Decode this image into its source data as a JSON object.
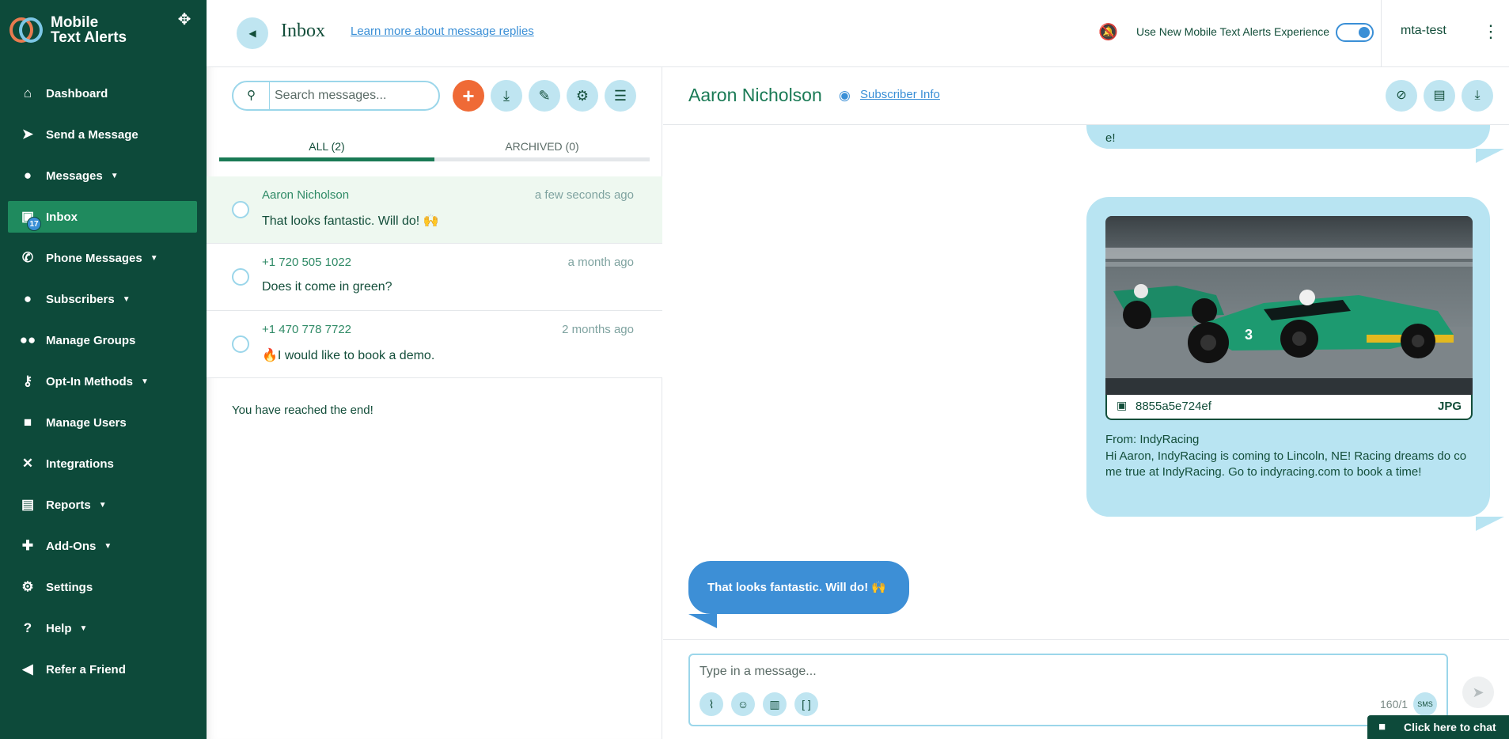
{
  "brand": {
    "line1": "Mobile",
    "line2": "Text Alerts"
  },
  "sidebar": {
    "items": [
      {
        "label": "Dashboard",
        "icon": "home-icon",
        "caret": false
      },
      {
        "label": "Send a Message",
        "icon": "send-icon",
        "caret": false
      },
      {
        "label": "Messages",
        "icon": "chat-bubble-icon",
        "caret": true
      },
      {
        "label": "Inbox",
        "icon": "inbox-icon",
        "caret": false,
        "badge": "17",
        "active": true
      },
      {
        "label": "Phone Messages",
        "icon": "phone-icon",
        "caret": true
      },
      {
        "label": "Subscribers",
        "icon": "person-icon",
        "caret": true
      },
      {
        "label": "Manage Groups",
        "icon": "groups-icon",
        "caret": false
      },
      {
        "label": "Opt-In Methods",
        "icon": "key-icon",
        "caret": true
      },
      {
        "label": "Manage Users",
        "icon": "lock-icon",
        "caret": false
      },
      {
        "label": "Integrations",
        "icon": "integrations-icon",
        "caret": false
      },
      {
        "label": "Reports",
        "icon": "report-icon",
        "caret": true
      },
      {
        "label": "Add-Ons",
        "icon": "puzzle-icon",
        "caret": true
      },
      {
        "label": "Settings",
        "icon": "gear-icon",
        "caret": false
      },
      {
        "label": "Help",
        "icon": "help-icon",
        "caret": true
      },
      {
        "label": "Refer a Friend",
        "icon": "megaphone-icon",
        "caret": false
      }
    ]
  },
  "header": {
    "title": "Inbox",
    "learn_link": "Learn more about message replies",
    "toggle_label": "Use New Mobile Text Alerts Experience",
    "toggle_on": true,
    "user": "mta-test"
  },
  "list": {
    "search_placeholder": "Search messages...",
    "tabs": [
      {
        "label": "ALL  (2)",
        "active": true
      },
      {
        "label": "ARCHIVED  (0)",
        "active": false
      }
    ],
    "messages": [
      {
        "name": "Aaron Nicholson",
        "time": "a few seconds ago",
        "text": "That looks fantastic. Will do! 🙌"
      },
      {
        "name": "+1 720 505 1022",
        "time": "a month ago",
        "text": "Does it come in green?"
      },
      {
        "name": "+1 470 778 7722",
        "time": "2 months ago",
        "text": "🔥I would like to book a demo."
      }
    ],
    "end_text": "You have reached the end!"
  },
  "conversation": {
    "name": "Aaron Nicholson",
    "subscriber_info": "Subscriber Info",
    "partial_top_text": "e!",
    "image_file": {
      "name": "8855a5e724ef",
      "ext": "JPG"
    },
    "from": "From: IndyRacing",
    "body": "Hi Aaron, IndyRacing is coming to Lincoln, NE! Racing dreams do come true at IndyRacing. Go to indyracing.com to book a time!",
    "reply": "That looks fantastic. Will do! 🙌"
  },
  "composer": {
    "placeholder": "Type in a message...",
    "char_count": "160/1",
    "sms_label": "SMS"
  },
  "chat_widget": {
    "label": "Click here to chat"
  },
  "colors": {
    "sidebar_bg": "#0d4a3a",
    "active_item": "#1f8a5e",
    "accent_blue": "#3a8fd6",
    "bubble_in": "#b8e4f2",
    "orange": "#ef6a36"
  }
}
